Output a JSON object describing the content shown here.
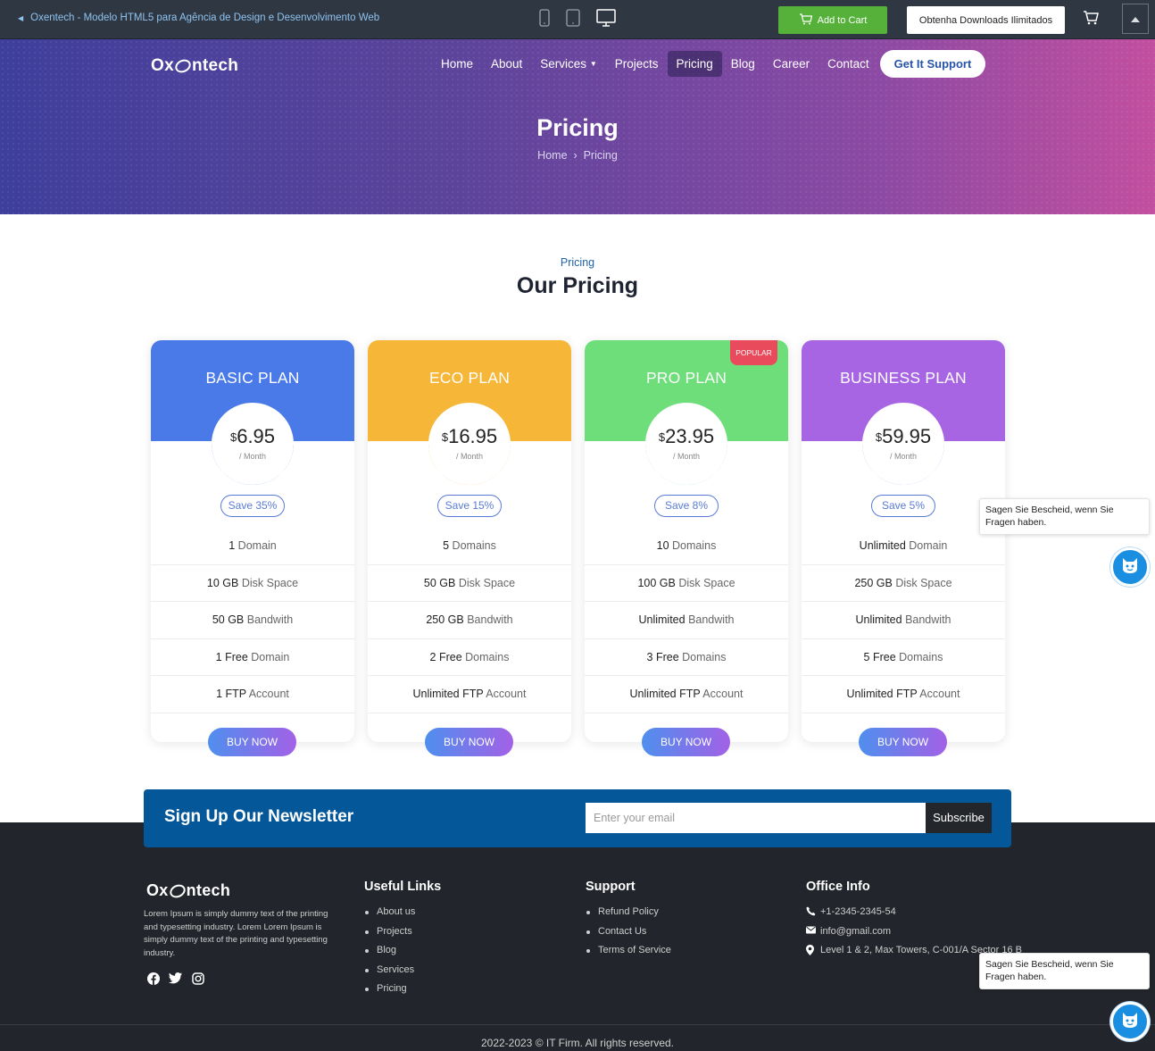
{
  "preview_bar": {
    "back_label": "Oxentech - Modelo HTML5 para Agência de Design e Desenvolvimento Web",
    "add_to_cart": "Add to Cart",
    "downloads": "Obtenha Downloads Ilimitados"
  },
  "header": {
    "logo": {
      "pre": "Ox",
      "post": "ntech"
    },
    "nav": [
      "Home",
      "About",
      "Services",
      "Projects",
      "Pricing",
      "Blog",
      "Career",
      "Contact"
    ],
    "active_nav": "Pricing",
    "support_button": "Get It Support"
  },
  "hero": {
    "title": "Pricing",
    "breadcrumb": {
      "home": "Home",
      "sep": "›",
      "current": "Pricing"
    }
  },
  "section": {
    "subtitle": "Pricing",
    "title": "Our Pricing"
  },
  "plans": [
    {
      "name": "BASIC PLAN",
      "color": "#4a7ae8",
      "currency": "$",
      "price": "6.95",
      "period": "/ Month",
      "save": "Save 35%",
      "features": [
        {
          "value": "1",
          "label": " Domain"
        },
        {
          "value": "10 GB",
          "label": " Disk Space"
        },
        {
          "value": "50 GB",
          "label": " Bandwith"
        },
        {
          "value": "1 Free",
          "label": " Domain"
        },
        {
          "value": "1 FTP",
          "label": " Account"
        }
      ],
      "button": "BUY NOW"
    },
    {
      "name": "ECO PLAN",
      "color": "#f6b637",
      "currency": "$",
      "price": "16.95",
      "period": "/ Month",
      "save": "Save 15%",
      "features": [
        {
          "value": "5",
          "label": " Domains"
        },
        {
          "value": "50 GB",
          "label": " Disk Space"
        },
        {
          "value": "250 GB",
          "label": " Bandwith"
        },
        {
          "value": "2 Free",
          "label": " Domains"
        },
        {
          "value": "Unlimited FTP",
          "label": " Account"
        }
      ],
      "button": "BUY NOW"
    },
    {
      "name": "PRO PLAN",
      "color": "#6ede7a",
      "currency": "$",
      "price": "23.95",
      "period": "/ Month",
      "save": "Save 8%",
      "badge": "POPULAR",
      "features": [
        {
          "value": "10",
          "label": " Domains"
        },
        {
          "value": "100 GB",
          "label": " Disk Space"
        },
        {
          "value": "Unlimited",
          "label": " Bandwith"
        },
        {
          "value": "3 Free",
          "label": " Domains"
        },
        {
          "value": "Unlimited FTP",
          "label": " Account"
        }
      ],
      "button": "BUY NOW"
    },
    {
      "name": "BUSINESS PLAN",
      "color": "#a764e3",
      "currency": "$",
      "price": "59.95",
      "period": "/ Month",
      "save": "Save 5%",
      "features": [
        {
          "value": "Unlimited",
          "label": " Domain"
        },
        {
          "value": "250 GB",
          "label": " Disk Space"
        },
        {
          "value": "Unlimited",
          "label": " Bandwith"
        },
        {
          "value": "5 Free",
          "label": " Domains"
        },
        {
          "value": "Unlimited FTP",
          "label": " Account"
        }
      ],
      "button": "BUY NOW"
    }
  ],
  "newsletter": {
    "title": "Sign Up Our Newsletter",
    "placeholder": "Enter your email",
    "button": "Subscribe"
  },
  "footer": {
    "about": "Lorem Ipsum is simply dummy text of the printing and typesetting industry. Lorem Lorem Ipsum is simply dummy text of the printing and typesetting industry.",
    "useful_links": {
      "title": "Useful Links",
      "items": [
        "About us",
        "Projects",
        "Blog",
        "Services",
        "Pricing"
      ]
    },
    "support": {
      "title": "Support",
      "items": [
        "Refund Policy",
        "Contact Us",
        "Terms of Service"
      ]
    },
    "office": {
      "title": "Office Info",
      "phone": "+1-2345-2345-54",
      "email": "info@gmail.com",
      "address": "Level 1 & 2, Max Towers, C-001/A Sector 16 B"
    },
    "copyright": "2022-2023 © IT Firm. All rights reserved."
  },
  "chat": {
    "message": "Sagen Sie Bescheid, wenn Sie Fragen haben."
  }
}
